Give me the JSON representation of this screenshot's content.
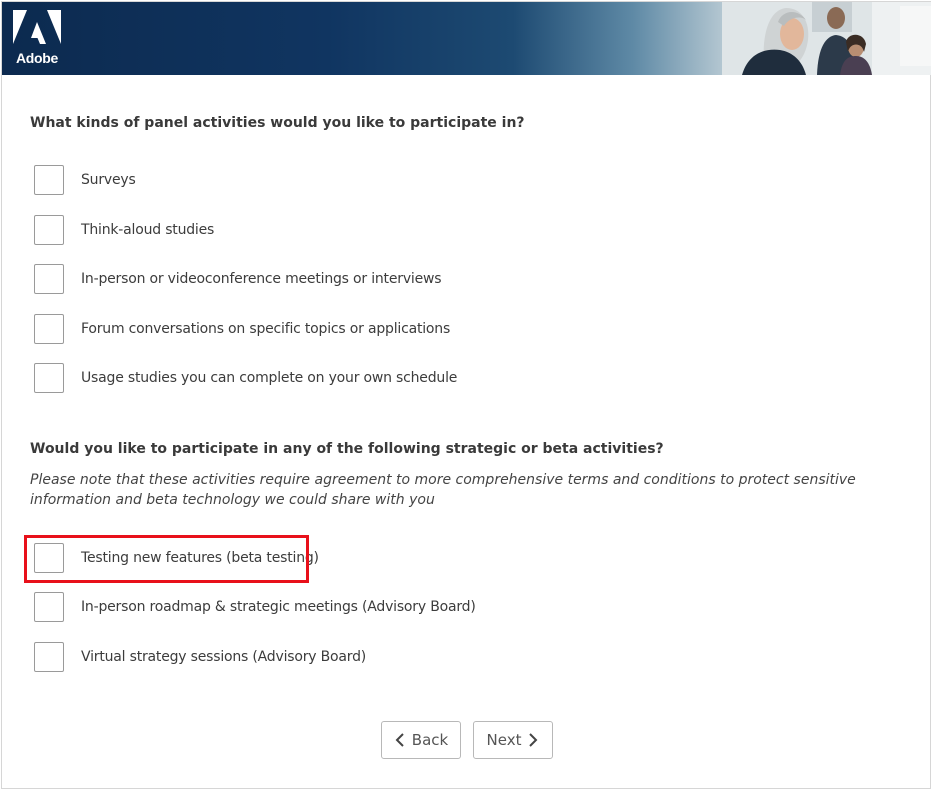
{
  "header": {
    "brand_name": "Adobe",
    "logo_icon": "adobe-logo-icon",
    "brand_color": "#0c2a4f"
  },
  "section1": {
    "question": "What kinds of panel activities would you like to participate in?",
    "options": [
      {
        "label": "Surveys",
        "checked": false
      },
      {
        "label": "Think-aloud studies",
        "checked": false
      },
      {
        "label": "In-person or videoconference meetings or interviews",
        "checked": false
      },
      {
        "label": "Forum conversations on specific topics or applications",
        "checked": false
      },
      {
        "label": "Usage studies you can complete on your own schedule",
        "checked": false
      }
    ]
  },
  "section2": {
    "question": "Would you like to participate in any of the following strategic or beta activities?",
    "note": "Please note that these activities require agreement to more comprehensive terms and conditions to protect sensitive information and beta technology we could share with you",
    "options": [
      {
        "label": "Testing new features (beta testing)",
        "checked": false,
        "highlighted": true
      },
      {
        "label": "In-person roadmap & strategic meetings (Advisory Board)",
        "checked": false
      },
      {
        "label": "Virtual strategy sessions (Advisory Board)",
        "checked": false
      }
    ]
  },
  "navigation": {
    "back_label": "Back",
    "back_icon": "chevron-left-icon",
    "next_label": "Next",
    "next_icon": "chevron-right-icon"
  },
  "colors": {
    "highlight": "#e8101a",
    "checkbox_border": "#9a9a9a"
  }
}
